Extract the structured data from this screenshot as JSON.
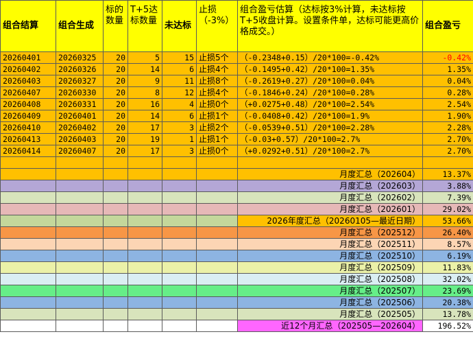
{
  "headers": {
    "combo_end": "组合结算",
    "combo_gen": "组合生成",
    "stock_count": "标的数量",
    "t5_reach": "T+5达标数量",
    "not_reach": "未达标",
    "stop_loss": "止损（-3%）",
    "estimate": "组合盈亏估算（达标按3%计算，未达标按T+5收盘计算。设置条件单，达标可能更高价格成交。）",
    "profit": "组合盈亏"
  },
  "rows": [
    {
      "end": "20260401",
      "gen": "20260325",
      "count": "20",
      "t5": "5",
      "miss": "15",
      "stop": "止损5个",
      "formula": "（-0.2348+0.15）/20*100=-0.42%",
      "profit": "-0.42%",
      "neg": true
    },
    {
      "end": "20260402",
      "gen": "20260326",
      "count": "20",
      "t5": "14",
      "miss": "6",
      "stop": "止损4个",
      "formula": "（-0.1495+0.42）/20*100=1.35%",
      "profit": "1.35%"
    },
    {
      "end": "20260403",
      "gen": "20260327",
      "count": "20",
      "t5": "9",
      "miss": "11",
      "stop": "止损8个",
      "formula": "（-0.2619+0.27）/20*100=0.04%",
      "profit": "0.04%"
    },
    {
      "end": "20260407",
      "gen": "20260330",
      "count": "20",
      "t5": "8",
      "miss": "12",
      "stop": "止损4个",
      "formula": "（-0.1846+0.24）/20*100=0.28%",
      "profit": "0.28%"
    },
    {
      "end": "20260408",
      "gen": "20260331",
      "count": "20",
      "t5": "16",
      "miss": "4",
      "stop": "止损0个",
      "formula": "（+0.0275+0.48）/20*100=2.54%",
      "profit": "2.54%"
    },
    {
      "end": "20260409",
      "gen": "20260401",
      "count": "20",
      "t5": "14",
      "miss": "6",
      "stop": "止损1个",
      "formula": "（-0.0408+0.42）/20*100=1.9%",
      "profit": "1.90%"
    },
    {
      "end": "20260410",
      "gen": "20260402",
      "count": "20",
      "t5": "17",
      "miss": "3",
      "stop": "止损2个",
      "formula": "（-0.0539+0.51）/20*100=2.28%",
      "profit": "2.28%"
    },
    {
      "end": "20260413",
      "gen": "20260403",
      "count": "20",
      "t5": "19",
      "miss": "1",
      "stop": "止损1个",
      "formula": "（-0.03+0.57）/20*100=2.7%",
      "profit": "2.70%"
    },
    {
      "end": "20260414",
      "gen": "20260407",
      "count": "20",
      "t5": "17",
      "miss": "3",
      "stop": "止损0个",
      "formula": "（+0.0292+0.51）/20*100=2.7%",
      "profit": "2.70%"
    }
  ],
  "summaries": [
    {
      "label": "月度汇总（202604）",
      "value": "13.37%",
      "color": "#ffc000",
      "valcolor": "#ffc000"
    },
    {
      "label": "月度汇总（202603）",
      "value": "3.88%",
      "color": "#b4a7d6",
      "valcolor": "#b4a7d6"
    },
    {
      "label": "月度汇总（202602）",
      "value": "7.39%",
      "color": "#d8e4bc",
      "valcolor": "#d8e4bc"
    },
    {
      "label": "月度汇总（202601）",
      "value": "29.02%",
      "color": "#e6b8b7",
      "valcolor": "#e6b8b7"
    },
    {
      "label": "2026年度汇总（20260105—最近日期）",
      "value": "53.66%",
      "color": "#c4d79b",
      "valcolor": "#ffc000",
      "labelcolor": "#ffc000"
    },
    {
      "label": "月度汇总（202512）",
      "value": "26.40%",
      "color": "#f79646",
      "valcolor": "#f79646"
    },
    {
      "label": "月度汇总（202511）",
      "value": "8.57%",
      "color": "#fcd5b4",
      "valcolor": "#fcd5b4"
    },
    {
      "label": "月度汇总（202510）",
      "value": "6.19%",
      "color": "#8db4e2",
      "valcolor": "#8db4e2"
    },
    {
      "label": "月度汇总（202509）",
      "value": "11.83%",
      "color": "#ebf1a8",
      "valcolor": "#ebf1a8"
    },
    {
      "label": "月度汇总（202508）",
      "value": "32.02%",
      "color": "#daeef3",
      "valcolor": "#daeef3"
    },
    {
      "label": "月度汇总（202507）",
      "value": "23.69%",
      "color": "#66ee88",
      "valcolor": "#66ee88"
    },
    {
      "label": "月度汇总（202506）",
      "value": "20.38%",
      "color": "#8db4e2",
      "valcolor": "#8db4e2"
    },
    {
      "label": "月度汇总（202505）",
      "value": "13.78%",
      "color": "#d8e4bc",
      "valcolor": "#d8e4bc"
    },
    {
      "label": "近12个月汇总（202505—202604）",
      "value": "196.52%",
      "color": "#ffffff",
      "valcolor": "#ffffff",
      "labelcolor": "#ff66ff"
    }
  ],
  "colors": {
    "header": "#ffff00",
    "data_row": "#ffc000",
    "negative": "#ff0000"
  }
}
